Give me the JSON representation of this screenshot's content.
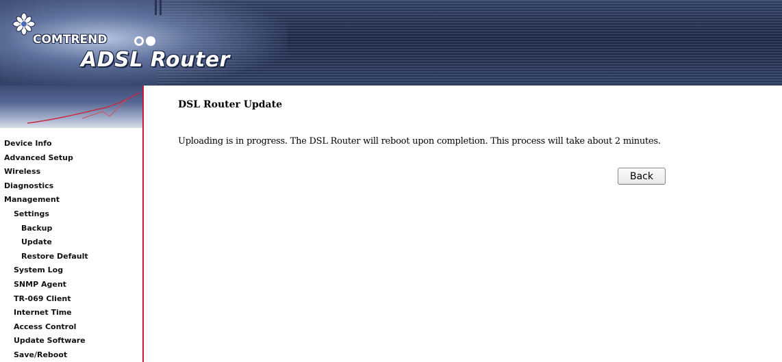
{
  "header": {
    "brand": "COMTREND",
    "product": "ADSL Router"
  },
  "sidebar": {
    "items": [
      {
        "label": "Device Info",
        "level": 0
      },
      {
        "label": "Advanced Setup",
        "level": 0
      },
      {
        "label": "Wireless",
        "level": 0
      },
      {
        "label": "Diagnostics",
        "level": 0
      },
      {
        "label": "Management",
        "level": 0
      },
      {
        "label": "Settings",
        "level": 1
      },
      {
        "label": "Backup",
        "level": 2
      },
      {
        "label": "Update",
        "level": 2
      },
      {
        "label": "Restore Default",
        "level": 2
      },
      {
        "label": "System Log",
        "level": 1
      },
      {
        "label": "SNMP Agent",
        "level": 1
      },
      {
        "label": "TR-069 Client",
        "level": 1
      },
      {
        "label": "Internet Time",
        "level": 1
      },
      {
        "label": "Access Control",
        "level": 1
      },
      {
        "label": "Update Software",
        "level": 1
      },
      {
        "label": "Save/Reboot",
        "level": 1
      }
    ]
  },
  "main": {
    "title": "DSL Router Update",
    "message": "Uploading is in progress. The DSL Router will reboot upon completion. This process will take about 2 minutes.",
    "back_label": "Back"
  },
  "colors": {
    "banner": "#2a3860",
    "sidebar_border": "#c8173b",
    "text": "#000000"
  }
}
